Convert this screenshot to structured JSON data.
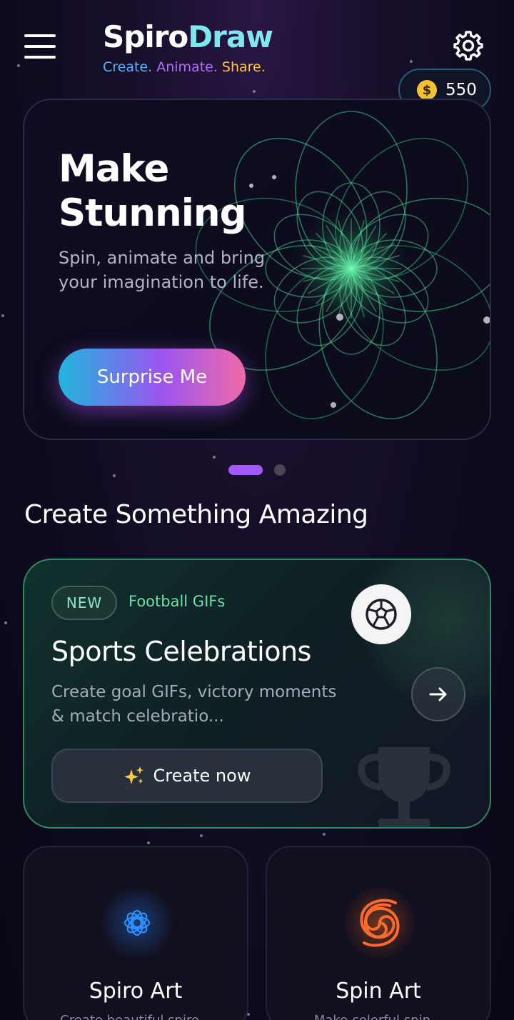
{
  "header": {
    "logo_part1": "Spiro",
    "logo_part2": "Draw",
    "tagline_1": "Create.",
    "tagline_2": "Animate.",
    "tagline_3": "Share.",
    "coins": "550",
    "coin_symbol": "$"
  },
  "hero": {
    "title": "Make Stunning",
    "subtitle": "Spin, animate and bring your imagination to life.",
    "button_label": "Surprise Me"
  },
  "carousel": {
    "active_index": 0,
    "count": 2
  },
  "section_title": "Create Something Amazing",
  "feature_card": {
    "badge": "NEW",
    "tag": "Football GIFs",
    "title": "Sports Celebrations",
    "description": "Create goal GIFs, victory moments & match celebratio...",
    "cta_label": "Create now",
    "accent_color": "#2f8a62"
  },
  "tiles": [
    {
      "title": "Spiro Art",
      "description": "Create beautiful spiro...",
      "icon": "spiro-flower-icon",
      "color": "#2e8fff"
    },
    {
      "title": "Spin Art",
      "description": "Make colorful spin...",
      "icon": "swirl-icon",
      "color": "#ff6a2a"
    }
  ],
  "colors": {
    "background": "#140e26",
    "accent_purple": "#a459ff",
    "coin_gold": "#f2c230"
  }
}
